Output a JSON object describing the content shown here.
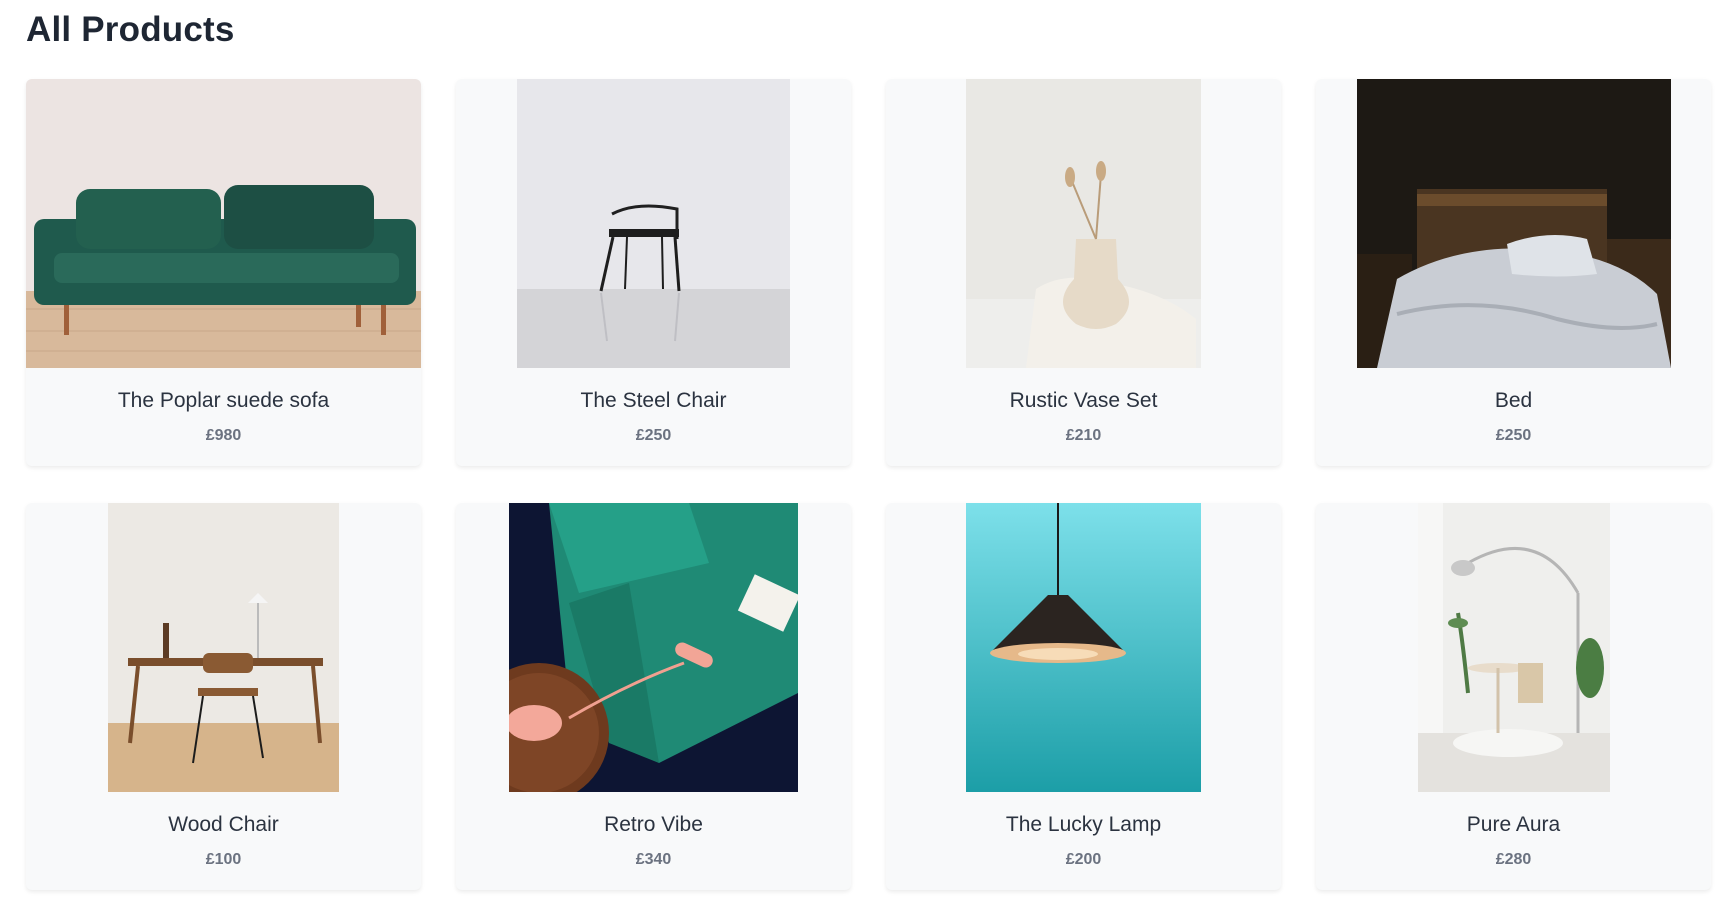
{
  "page": {
    "title": "All Products"
  },
  "products": [
    {
      "name": "The Poplar suede sofa",
      "price": "£980",
      "image": "green-velvet-sofa-photo"
    },
    {
      "name": "The Steel Chair",
      "price": "£250",
      "image": "black-steel-chair-photo"
    },
    {
      "name": "Rustic Vase Set",
      "price": "£210",
      "image": "ceramic-vase-photo"
    },
    {
      "name": "Bed",
      "price": "£250",
      "image": "wooden-bed-photo"
    },
    {
      "name": "Wood Chair",
      "price": "£100",
      "image": "wood-desk-chair-photo"
    },
    {
      "name": "Retro Vibe",
      "price": "£340",
      "image": "teal-sofa-retro-phone-photo"
    },
    {
      "name": "The Lucky Lamp",
      "price": "£200",
      "image": "pendant-lamp-photo"
    },
    {
      "name": "Pure Aura",
      "price": "£280",
      "image": "white-room-arc-lamp-photo"
    }
  ],
  "colors": {
    "card_background": "#f8f9fa",
    "title_text": "#1e2633",
    "price_text": "#6b7280"
  }
}
